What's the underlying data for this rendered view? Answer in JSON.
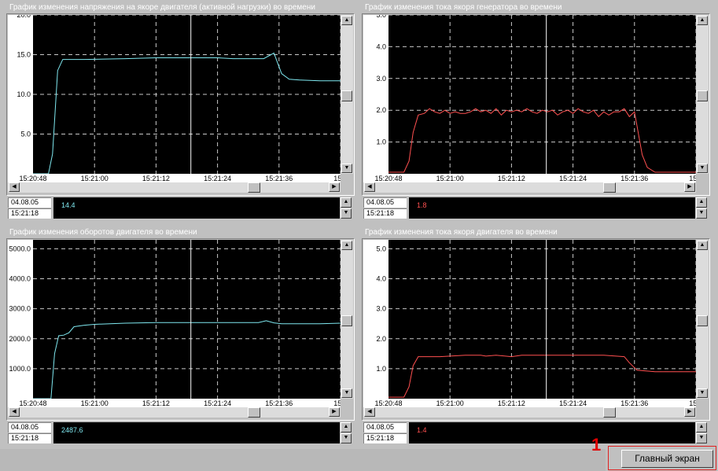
{
  "panels": [
    {
      "title": "График изменения напряжения на якоре двигателя (активной нагрузки) во времени",
      "date": "04.08.05",
      "time": "15:21:18",
      "current_value": "14.4",
      "color": "#7fe8f0",
      "hthumb": 0.77
    },
    {
      "title": "График изменения тока якоря генератора во времени",
      "date": "04.08.05",
      "time": "15:21:18",
      "current_value": "1.8",
      "color": "#ff5050",
      "hthumb": 0.77
    },
    {
      "title": "График изменения оборотов двигателя во времени",
      "date": "04.08.05",
      "time": "15:21:18",
      "current_value": "2487.6",
      "color": "#7fe8f0",
      "hthumb": 0.77
    },
    {
      "title": "График изменения тока якоря двигателя во времени",
      "date": "04.08.05",
      "time": "15:21:18",
      "current_value": "1.4",
      "color": "#ff5050",
      "hthumb": 0.77
    }
  ],
  "chart_data": [
    {
      "type": "line",
      "title": "График изменения напряжения на якоре двигателя (активной нагрузки) во времени",
      "xlabel": "",
      "ylabel": "",
      "x_ticks": [
        "15:20:48",
        "15:21:00",
        "15:21:12",
        "15:21:24",
        "15:21:36",
        "15:2"
      ],
      "y_ticks": [
        "20.0",
        "15.0",
        "10.0",
        "5.0"
      ],
      "ylim": [
        0,
        20
      ],
      "xlim": [
        0,
        60
      ],
      "cursor_x": 30.8,
      "grid": true,
      "x": [
        0,
        3,
        3.8,
        4.8,
        5.8,
        10,
        18,
        24,
        30,
        36,
        39,
        40,
        45,
        47,
        48.5,
        50,
        52,
        56,
        60
      ],
      "values": [
        0,
        0,
        2.5,
        13,
        14.4,
        14.4,
        14.5,
        14.6,
        14.6,
        14.6,
        14.5,
        14.5,
        14.5,
        15.2,
        12.6,
        11.9,
        11.8,
        11.7,
        11.7
      ]
    },
    {
      "type": "line",
      "title": "График изменения тока якоря генератора во времени",
      "xlabel": "",
      "ylabel": "",
      "x_ticks": [
        "15:20:48",
        "15:21:00",
        "15:21:12",
        "15:21:24",
        "15:21:36",
        "15:2"
      ],
      "y_ticks": [
        "5.0",
        "4.0",
        "3.0",
        "2.0",
        "1.0"
      ],
      "ylim": [
        0,
        5
      ],
      "xlim": [
        0,
        60
      ],
      "cursor_x": 30.8,
      "grid": true,
      "x": [
        0,
        3,
        4,
        4.8,
        5.8,
        7,
        8,
        9,
        10,
        11,
        12,
        13,
        14,
        15,
        16,
        17,
        18,
        19,
        20,
        21,
        22,
        23,
        24,
        25,
        26,
        27,
        28,
        29,
        30,
        31,
        32,
        33,
        34,
        35,
        36,
        37,
        38,
        39,
        40,
        41,
        42,
        43,
        44,
        45,
        46,
        47,
        48,
        49.5,
        50.5,
        52,
        56,
        60
      ],
      "values": [
        0.05,
        0.05,
        0.4,
        1.3,
        1.85,
        1.9,
        2.05,
        1.95,
        1.9,
        2.0,
        1.9,
        1.95,
        1.9,
        1.9,
        1.95,
        2.05,
        1.95,
        2.0,
        1.9,
        2.05,
        1.85,
        2.0,
        1.95,
        2.0,
        1.95,
        2.05,
        1.95,
        1.9,
        2.0,
        1.95,
        2.0,
        1.85,
        1.95,
        2.0,
        1.9,
        2.05,
        1.95,
        1.9,
        2.0,
        1.8,
        1.95,
        1.85,
        1.95,
        1.95,
        2.05,
        1.8,
        1.95,
        0.6,
        0.2,
        0.05,
        0.05,
        0.05
      ]
    },
    {
      "type": "line",
      "title": "График изменения оборотов двигателя во времени",
      "xlabel": "",
      "ylabel": "",
      "x_ticks": [
        "15:20:48",
        "15:21:00",
        "15:21:12",
        "15:21:24",
        "15:21:36",
        "15:2"
      ],
      "y_ticks": [
        "5000.0",
        "4000.0",
        "3000.0",
        "2000.0",
        "1000.0"
      ],
      "ylim": [
        0,
        5300
      ],
      "xlim": [
        0,
        60
      ],
      "cursor_x": 30.8,
      "grid": true,
      "x": [
        0,
        3.5,
        4.2,
        5,
        6,
        7,
        8,
        10,
        12,
        15,
        18,
        21,
        24,
        30,
        36,
        42,
        44,
        45.5,
        47,
        48.5,
        52,
        56,
        60
      ],
      "values": [
        0,
        0,
        1500,
        2100,
        2120,
        2200,
        2400,
        2450,
        2480,
        2500,
        2520,
        2530,
        2540,
        2540,
        2540,
        2540,
        2540,
        2600,
        2530,
        2500,
        2500,
        2500,
        2520
      ]
    },
    {
      "type": "line",
      "title": "График изменения тока якоря двигателя во времени",
      "xlabel": "",
      "ylabel": "",
      "x_ticks": [
        "15:20:48",
        "15:21:00",
        "15:21:12",
        "15:21:24",
        "15:21:36",
        "15:2"
      ],
      "y_ticks": [
        "5.0",
        "4.0",
        "3.0",
        "2.0",
        "1.0"
      ],
      "ylim": [
        0,
        5.3
      ],
      "xlim": [
        0,
        60
      ],
      "cursor_x": 30.8,
      "grid": true,
      "x": [
        0,
        3,
        4,
        4.8,
        5.8,
        10,
        15,
        18,
        19,
        21,
        24,
        26,
        27,
        30,
        36,
        42,
        46,
        47,
        48.5,
        52,
        56,
        60
      ],
      "values": [
        0.05,
        0.05,
        0.4,
        1.1,
        1.4,
        1.4,
        1.45,
        1.45,
        1.42,
        1.45,
        1.4,
        1.45,
        1.45,
        1.45,
        1.45,
        1.45,
        1.4,
        1.2,
        0.95,
        0.9,
        0.9,
        0.9
      ]
    }
  ],
  "footer": {
    "main_button_label": "Главный экран",
    "annotation_number": "1"
  }
}
